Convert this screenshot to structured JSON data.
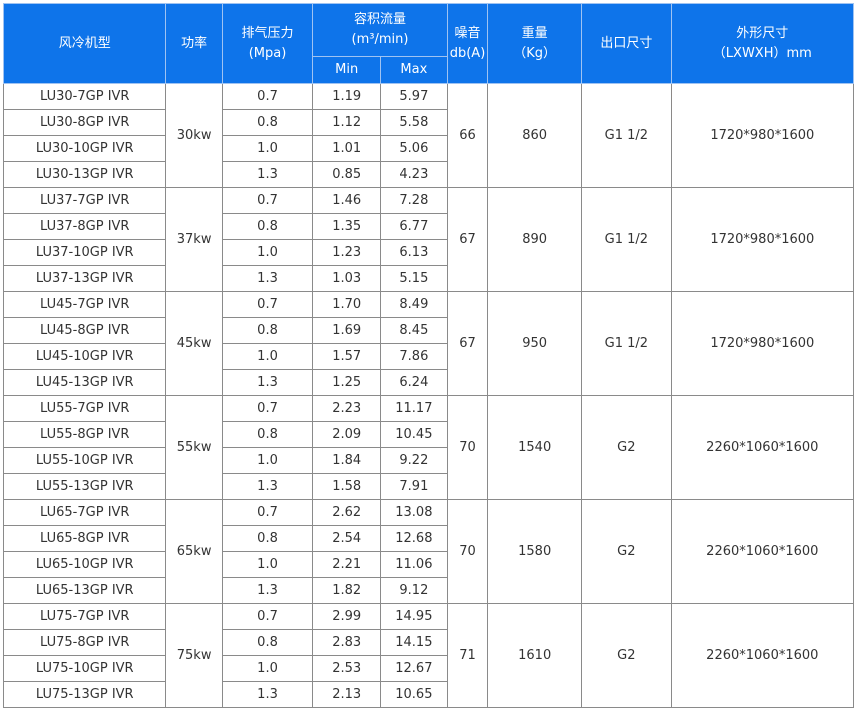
{
  "headers": {
    "model": "风冷机型",
    "power": "功率",
    "pressure": {
      "line1": "排气压力",
      "line2": "(Mpa)"
    },
    "flow": {
      "line1": "容积流量",
      "line2": "(m³/min)"
    },
    "min": "Min",
    "max": "Max",
    "noise": {
      "line1": "噪音",
      "line2": "db(A)"
    },
    "weight": {
      "line1": "重量",
      "line2": "（Kg）"
    },
    "outlet": "出口尺寸",
    "dimensions": {
      "line1": "外形尺寸",
      "line2": "（LXWXH）mm"
    }
  },
  "groups": [
    {
      "power": "30kw",
      "noise": "66",
      "weight": "860",
      "outlet": "G1 1/2",
      "dimensions": "1720*980*1600",
      "rows": [
        {
          "model": "LU30-7GP IVR",
          "pressure": "0.7",
          "min": "1.19",
          "max": "5.97"
        },
        {
          "model": "LU30-8GP IVR",
          "pressure": "0.8",
          "min": "1.12",
          "max": "5.58"
        },
        {
          "model": "LU30-10GP IVR",
          "pressure": "1.0",
          "min": "1.01",
          "max": "5.06"
        },
        {
          "model": "LU30-13GP IVR",
          "pressure": "1.3",
          "min": "0.85",
          "max": "4.23"
        }
      ]
    },
    {
      "power": "37kw",
      "noise": "67",
      "weight": "890",
      "outlet": "G1 1/2",
      "dimensions": "1720*980*1600",
      "rows": [
        {
          "model": "LU37-7GP IVR",
          "pressure": "0.7",
          "min": "1.46",
          "max": "7.28"
        },
        {
          "model": "LU37-8GP IVR",
          "pressure": "0.8",
          "min": "1.35",
          "max": "6.77"
        },
        {
          "model": "LU37-10GP IVR",
          "pressure": "1.0",
          "min": "1.23",
          "max": "6.13"
        },
        {
          "model": "LU37-13GP IVR",
          "pressure": "1.3",
          "min": "1.03",
          "max": "5.15"
        }
      ]
    },
    {
      "power": "45kw",
      "noise": "67",
      "weight": "950",
      "outlet": "G1 1/2",
      "dimensions": "1720*980*1600",
      "rows": [
        {
          "model": "LU45-7GP IVR",
          "pressure": "0.7",
          "min": "1.70",
          "max": "8.49"
        },
        {
          "model": "LU45-8GP IVR",
          "pressure": "0.8",
          "min": "1.69",
          "max": "8.45"
        },
        {
          "model": "LU45-10GP IVR",
          "pressure": "1.0",
          "min": "1.57",
          "max": "7.86"
        },
        {
          "model": "LU45-13GP IVR",
          "pressure": "1.3",
          "min": "1.25",
          "max": "6.24"
        }
      ]
    },
    {
      "power": "55kw",
      "noise": "70",
      "weight": "1540",
      "outlet": "G2",
      "dimensions": "2260*1060*1600",
      "rows": [
        {
          "model": "LU55-7GP IVR",
          "pressure": "0.7",
          "min": "2.23",
          "max": "11.17"
        },
        {
          "model": "LU55-8GP IVR",
          "pressure": "0.8",
          "min": "2.09",
          "max": "10.45"
        },
        {
          "model": "LU55-10GP IVR",
          "pressure": "1.0",
          "min": "1.84",
          "max": "9.22"
        },
        {
          "model": "LU55-13GP IVR",
          "pressure": "1.3",
          "min": "1.58",
          "max": "7.91"
        }
      ]
    },
    {
      "power": "65kw",
      "noise": "70",
      "weight": "1580",
      "outlet": "G2",
      "dimensions": "2260*1060*1600",
      "rows": [
        {
          "model": "LU65-7GP IVR",
          "pressure": "0.7",
          "min": "2.62",
          "max": "13.08"
        },
        {
          "model": "LU65-8GP IVR",
          "pressure": "0.8",
          "min": "2.54",
          "max": "12.68"
        },
        {
          "model": "LU65-10GP IVR",
          "pressure": "1.0",
          "min": "2.21",
          "max": "11.06"
        },
        {
          "model": "LU65-13GP IVR",
          "pressure": "1.3",
          "min": "1.82",
          "max": "9.12"
        }
      ]
    },
    {
      "power": "75kw",
      "noise": "71",
      "weight": "1610",
      "outlet": "G2",
      "dimensions": "2260*1060*1600",
      "rows": [
        {
          "model": "LU75-7GP IVR",
          "pressure": "0.7",
          "min": "2.99",
          "max": "14.95"
        },
        {
          "model": "LU75-8GP IVR",
          "pressure": "0.8",
          "min": "2.83",
          "max": "14.15"
        },
        {
          "model": "LU75-10GP IVR",
          "pressure": "1.0",
          "min": "2.53",
          "max": "12.67"
        },
        {
          "model": "LU75-13GP IVR",
          "pressure": "1.3",
          "min": "2.13",
          "max": "10.65"
        }
      ]
    }
  ],
  "colors": {
    "header_bg": "#0e74ea",
    "header_text": "#ffffff",
    "border": "#8a8a8a",
    "body_text": "#333333"
  }
}
